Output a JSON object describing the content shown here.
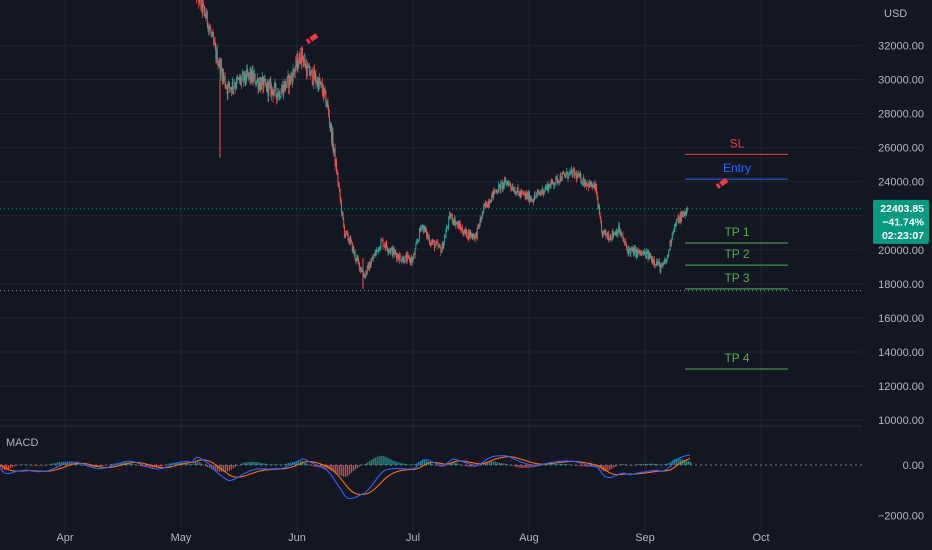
{
  "chart_data": {
    "type": "candlestick",
    "currency": "USD",
    "price_ticks": [
      32000,
      30000,
      28000,
      26000,
      24000,
      22000,
      20000,
      18000,
      16000,
      14000,
      12000,
      10000
    ],
    "price_tick_labels": [
      "32000.00",
      "30000.00",
      "28000.00",
      "26000.00",
      "24000.00",
      "22000.00",
      "20000.00",
      "18000.00",
      "16000.00",
      "14000.00",
      "12000.00",
      "10000.00"
    ],
    "months": [
      "Apr",
      "May",
      "Jun",
      "Jul",
      "Aug",
      "Sep",
      "Oct"
    ],
    "price_path": [
      [
        0,
        35500
      ],
      [
        5,
        33500
      ],
      [
        8,
        31500
      ],
      [
        12,
        29500
      ],
      [
        15,
        29800
      ],
      [
        20,
        30200
      ],
      [
        25,
        29600
      ],
      [
        30,
        29200
      ],
      [
        34,
        30000
      ],
      [
        38,
        31500
      ],
      [
        40,
        30500
      ],
      [
        43,
        30000
      ],
      [
        45,
        29500
      ],
      [
        47,
        28500
      ],
      [
        50,
        25000
      ],
      [
        53,
        21000
      ],
      [
        55,
        20500
      ],
      [
        57,
        19500
      ],
      [
        60,
        18500
      ],
      [
        63,
        19500
      ],
      [
        66,
        20500
      ],
      [
        69,
        20000
      ],
      [
        73,
        19500
      ],
      [
        77,
        19400
      ],
      [
        80,
        21500
      ],
      [
        83,
        20500
      ],
      [
        87,
        20000
      ],
      [
        90,
        22000
      ],
      [
        95,
        21000
      ],
      [
        99,
        20800
      ],
      [
        102,
        22500
      ],
      [
        106,
        23500
      ],
      [
        110,
        24000
      ],
      [
        114,
        23300
      ],
      [
        119,
        23000
      ],
      [
        124,
        23700
      ],
      [
        129,
        24300
      ],
      [
        133,
        24500
      ],
      [
        137,
        24000
      ],
      [
        141,
        23600
      ],
      [
        143,
        21000
      ],
      [
        146,
        20800
      ],
      [
        149,
        21200
      ],
      [
        152,
        20000
      ],
      [
        156,
        19800
      ],
      [
        159,
        19700
      ],
      [
        162,
        19300
      ],
      [
        164,
        18900
      ],
      [
        166,
        19500
      ],
      [
        168,
        21200
      ],
      [
        170,
        21800
      ],
      [
        172,
        22100
      ],
      [
        173,
        22404
      ]
    ],
    "last_price": {
      "value": 22403.85,
      "price_text": "22403.85",
      "change_text": "−41.74%",
      "countdown_text": "02:23:07",
      "color": "#089981"
    },
    "levels": [
      {
        "label": "SL",
        "price": 25600,
        "color": "#f23645"
      },
      {
        "label": "Entry",
        "price": 24150,
        "color": "#2962ff"
      },
      {
        "label": "TP 1",
        "price": 20400,
        "color": "#4caf50"
      },
      {
        "label": "TP 2",
        "price": 19100,
        "color": "#4caf50"
      },
      {
        "label": "TP 3",
        "price": 17700,
        "color": "#4caf50"
      },
      {
        "label": "TP 4",
        "price": 13000,
        "color": "#4caf50"
      }
    ],
    "markers": [
      {
        "icon": "pencil-icon",
        "price": 32400,
        "color": "#f23645"
      },
      {
        "icon": "pencil-icon",
        "price": 23900,
        "color": "#f23645"
      }
    ],
    "indicator": {
      "name": "MACD",
      "ticks": [
        0,
        -2000
      ],
      "tick_labels": [
        "0.00",
        "−2000.00"
      ],
      "macd_color": "#2962ff",
      "signal_color": "#ff6d00",
      "hist_up_color": "#26a69a",
      "hist_down_color": "#ef5350"
    },
    "colors": {
      "background": "#131722",
      "grid": "#1f2433",
      "candle_up": "#26a69a",
      "candle_down": "#ef5350"
    }
  }
}
